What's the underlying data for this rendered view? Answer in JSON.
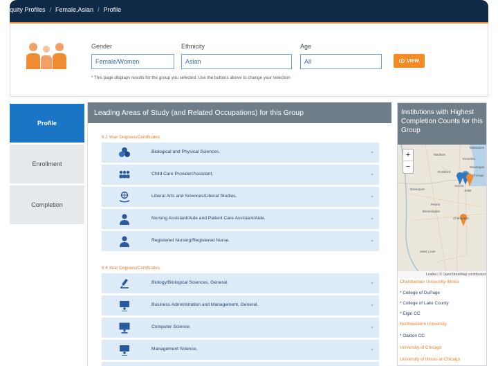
{
  "breadcrumb": {
    "items": [
      "quity Profiles",
      "Female,Asian",
      "Profile"
    ],
    "separator": "/"
  },
  "filters": {
    "gender": {
      "label": "Gender",
      "value": "Female/Women"
    },
    "ethnicity": {
      "label": "Ethnicity",
      "value": "Asian"
    },
    "age": {
      "label": "Age",
      "value": "All"
    },
    "view_button": "VIEW",
    "note": "* This page displays results for the group you selected. Use the buttons above to change your selection"
  },
  "tabs": [
    {
      "label": "Profile",
      "active": true
    },
    {
      "label": "Enrollment",
      "active": false
    },
    {
      "label": "Completion",
      "active": false
    }
  ],
  "main": {
    "header": "Leading Areas of Study (and Related Occupations) for this Group",
    "sections": [
      {
        "title": "2 Year Degrees/Certificates",
        "items": [
          {
            "label": "Biological and Physical Sciences.",
            "icon": "molecule-icon"
          },
          {
            "label": "Child Care Provider/Assistant.",
            "icon": "group-icon"
          },
          {
            "label": "Liberal Arts and Sciences/Liberal Studies.",
            "icon": "globe-hand-icon"
          },
          {
            "label": "Nursing Assistant/Aide and Patient Care Assistant/Aide.",
            "icon": "nurse-icon"
          },
          {
            "label": "Registered Nursing/Registered Nurse.",
            "icon": "nurse-icon"
          }
        ]
      },
      {
        "title": "4 Year Degrees/Certificates",
        "items": [
          {
            "label": "Biology/Biological Sciences, General.",
            "icon": "microscope-icon"
          },
          {
            "label": "Business Administration and Management, General.",
            "icon": "presentation-icon"
          },
          {
            "label": "Computer Science.",
            "icon": "monitor-icon"
          },
          {
            "label": "Management Science.",
            "icon": "presentation-icon"
          }
        ]
      }
    ]
  },
  "side": {
    "header": "Institutions with Highest Completion Counts for this Group",
    "map": {
      "zoom_in": "+",
      "zoom_out": "−",
      "places": [
        "Milwaukee",
        "Madison",
        "Kenosha",
        "Waukegan",
        "Rockford",
        "Aurora",
        "Davenport",
        "Peoria",
        "Bloomington",
        "Champaign",
        "Saint Louis",
        "Chicago",
        "Joliet"
      ],
      "attribution": "Leaflet | © OpenStreetMap contributors"
    },
    "institutions": [
      {
        "name": "Chamberlain University-Illinois",
        "type": "university"
      },
      {
        "name": "* College of DuPage",
        "type": "college"
      },
      {
        "name": "* College of Lake County",
        "type": "college"
      },
      {
        "name": "* Elgin CC",
        "type": "college"
      },
      {
        "name": "Northwestern University",
        "type": "university"
      },
      {
        "name": "* Oakton CC",
        "type": "college"
      },
      {
        "name": "University of Chicago",
        "type": "university"
      },
      {
        "name": "University of Illinois at Chicago",
        "type": "university"
      }
    ]
  },
  "colors": {
    "navy": "#0e2a47",
    "accent_orange": "#f08a33",
    "active_tab": "#1a75c4",
    "row_bg": "#dcebf7",
    "header_gray": "#6f7d89"
  }
}
